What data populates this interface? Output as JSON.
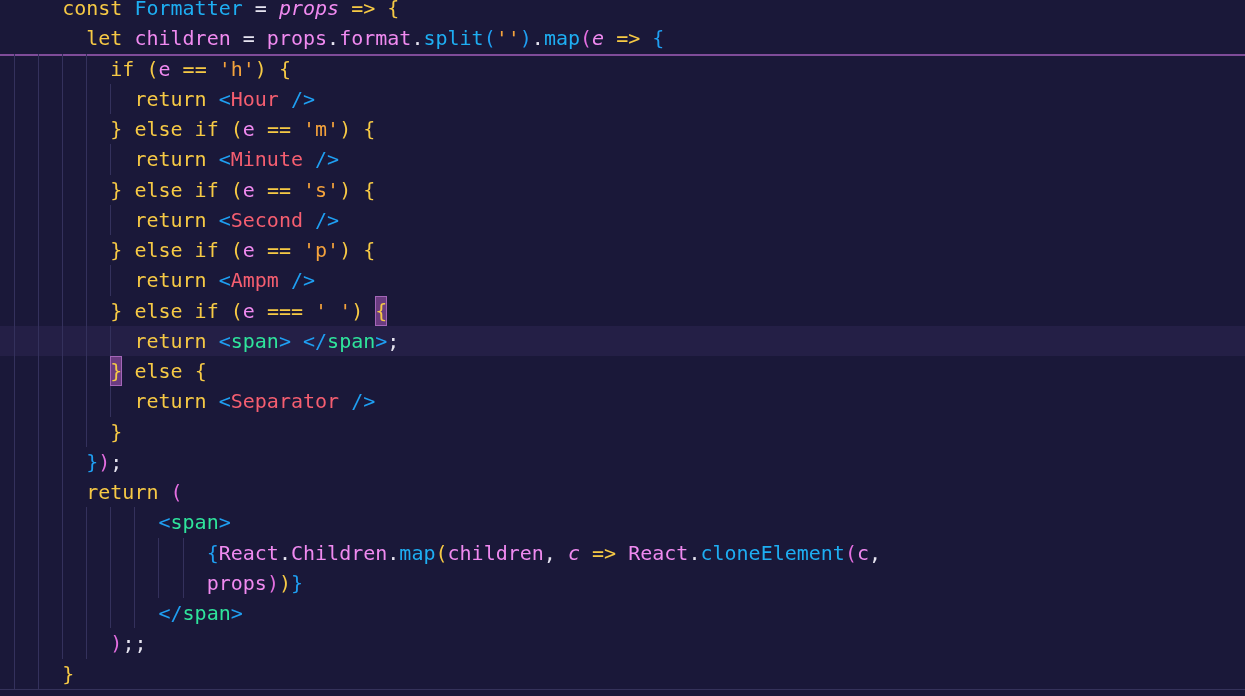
{
  "sticky_lines": [
    {
      "tokens": [
        {
          "text": "    const ",
          "kind": "kw"
        },
        {
          "text": "Formatter",
          "kind": "fn"
        },
        {
          "text": " = ",
          "kind": "plain"
        },
        {
          "text": "props",
          "kind": "param"
        },
        {
          "text": " => ",
          "kind": "kw"
        },
        {
          "text": "{",
          "kind": "b1"
        }
      ]
    },
    {
      "tokens": [
        {
          "text": "      let ",
          "kind": "kw"
        },
        {
          "text": "children",
          "kind": "var"
        },
        {
          "text": " = ",
          "kind": "plain"
        },
        {
          "text": "props",
          "kind": "var"
        },
        {
          "text": ".",
          "kind": "plain"
        },
        {
          "text": "format",
          "kind": "var"
        },
        {
          "text": ".",
          "kind": "plain"
        },
        {
          "text": "split",
          "kind": "fn"
        },
        {
          "text": "(",
          "kind": "b3"
        },
        {
          "text": "''",
          "kind": "str"
        },
        {
          "text": ")",
          "kind": "b3"
        },
        {
          "text": ".",
          "kind": "plain"
        },
        {
          "text": "map",
          "kind": "fn"
        },
        {
          "text": "(",
          "kind": "b2"
        },
        {
          "text": "e",
          "kind": "param"
        },
        {
          "text": " => ",
          "kind": "kw"
        },
        {
          "text": "{",
          "kind": "b3"
        }
      ]
    }
  ],
  "lines": [
    {
      "current": false,
      "tokens": [
        {
          "text": "        if ",
          "kind": "kw"
        },
        {
          "text": "(",
          "kind": "b1"
        },
        {
          "text": "e",
          "kind": "var"
        },
        {
          "text": " == ",
          "kind": "kw"
        },
        {
          "text": "'h'",
          "kind": "str"
        },
        {
          "text": ") ",
          "kind": "b1"
        },
        {
          "text": "{",
          "kind": "b1"
        }
      ]
    },
    {
      "current": false,
      "tokens": [
        {
          "text": "          return ",
          "kind": "kw"
        },
        {
          "text": "<",
          "kind": "angle"
        },
        {
          "text": "Hour",
          "kind": "comp"
        },
        {
          "text": " />",
          "kind": "angle"
        }
      ]
    },
    {
      "current": false,
      "tokens": [
        {
          "text": "        }",
          "kind": "b1"
        },
        {
          "text": " else if ",
          "kind": "kw"
        },
        {
          "text": "(",
          "kind": "b1"
        },
        {
          "text": "e",
          "kind": "var"
        },
        {
          "text": " == ",
          "kind": "kw"
        },
        {
          "text": "'m'",
          "kind": "str"
        },
        {
          "text": ") ",
          "kind": "b1"
        },
        {
          "text": "{",
          "kind": "b1"
        }
      ]
    },
    {
      "current": false,
      "tokens": [
        {
          "text": "          return ",
          "kind": "kw"
        },
        {
          "text": "<",
          "kind": "angle"
        },
        {
          "text": "Minute",
          "kind": "comp"
        },
        {
          "text": " />",
          "kind": "angle"
        }
      ]
    },
    {
      "current": false,
      "tokens": [
        {
          "text": "        }",
          "kind": "b1"
        },
        {
          "text": " else if ",
          "kind": "kw"
        },
        {
          "text": "(",
          "kind": "b1"
        },
        {
          "text": "e",
          "kind": "var"
        },
        {
          "text": " == ",
          "kind": "kw"
        },
        {
          "text": "'s'",
          "kind": "str"
        },
        {
          "text": ") ",
          "kind": "b1"
        },
        {
          "text": "{",
          "kind": "b1"
        }
      ]
    },
    {
      "current": false,
      "tokens": [
        {
          "text": "          return ",
          "kind": "kw"
        },
        {
          "text": "<",
          "kind": "angle"
        },
        {
          "text": "Second",
          "kind": "comp"
        },
        {
          "text": " />",
          "kind": "angle"
        }
      ]
    },
    {
      "current": false,
      "tokens": [
        {
          "text": "        }",
          "kind": "b1"
        },
        {
          "text": " else if ",
          "kind": "kw"
        },
        {
          "text": "(",
          "kind": "b1"
        },
        {
          "text": "e",
          "kind": "var"
        },
        {
          "text": " == ",
          "kind": "kw"
        },
        {
          "text": "'p'",
          "kind": "str"
        },
        {
          "text": ") ",
          "kind": "b1"
        },
        {
          "text": "{",
          "kind": "b1"
        }
      ]
    },
    {
      "current": false,
      "tokens": [
        {
          "text": "          return ",
          "kind": "kw"
        },
        {
          "text": "<",
          "kind": "angle"
        },
        {
          "text": "Ampm",
          "kind": "comp"
        },
        {
          "text": " />",
          "kind": "angle"
        }
      ]
    },
    {
      "current": false,
      "tokens": [
        {
          "text": "        }",
          "kind": "b1"
        },
        {
          "text": " else if ",
          "kind": "kw"
        },
        {
          "text": "(",
          "kind": "b1"
        },
        {
          "text": "e",
          "kind": "var"
        },
        {
          "text": " === ",
          "kind": "kw"
        },
        {
          "text": "' '",
          "kind": "str"
        },
        {
          "text": ") ",
          "kind": "b1"
        },
        {
          "text": "{",
          "kind": "b1",
          "matched": true
        }
      ]
    },
    {
      "current": true,
      "tokens": [
        {
          "text": "          return ",
          "kind": "kw"
        },
        {
          "text": "<",
          "kind": "angle"
        },
        {
          "text": "span",
          "kind": "tag"
        },
        {
          "text": "> </",
          "kind": "angle"
        },
        {
          "text": "span",
          "kind": "tag"
        },
        {
          "text": ">",
          "kind": "angle"
        },
        {
          "text": ";",
          "kind": "plain"
        }
      ]
    },
    {
      "current": false,
      "tokens": [
        {
          "text": "        }",
          "kind": "b1",
          "matched": true
        },
        {
          "text": " else ",
          "kind": "kw"
        },
        {
          "text": "{",
          "kind": "b1"
        }
      ]
    },
    {
      "current": false,
      "tokens": [
        {
          "text": "          return ",
          "kind": "kw"
        },
        {
          "text": "<",
          "kind": "angle"
        },
        {
          "text": "Separator",
          "kind": "comp"
        },
        {
          "text": " />",
          "kind": "angle"
        }
      ]
    },
    {
      "current": false,
      "tokens": [
        {
          "text": "        }",
          "kind": "b1"
        }
      ]
    },
    {
      "current": false,
      "tokens": [
        {
          "text": "      }",
          "kind": "b3"
        },
        {
          "text": ")",
          "kind": "b2"
        },
        {
          "text": ";",
          "kind": "plain"
        }
      ]
    },
    {
      "current": false,
      "tokens": [
        {
          "text": "      return ",
          "kind": "kw"
        },
        {
          "text": "(",
          "kind": "b2"
        }
      ]
    },
    {
      "current": false,
      "tokens": [
        {
          "text": "            <",
          "kind": "angle"
        },
        {
          "text": "span",
          "kind": "tag"
        },
        {
          "text": ">",
          "kind": "angle"
        }
      ]
    },
    {
      "current": false,
      "tokens": [
        {
          "text": "                {",
          "kind": "b3"
        },
        {
          "text": "React",
          "kind": "var"
        },
        {
          "text": ".",
          "kind": "plain"
        },
        {
          "text": "Children",
          "kind": "var"
        },
        {
          "text": ".",
          "kind": "plain"
        },
        {
          "text": "map",
          "kind": "fn"
        },
        {
          "text": "(",
          "kind": "b1"
        },
        {
          "text": "children",
          "kind": "var"
        },
        {
          "text": ", ",
          "kind": "plain"
        },
        {
          "text": "c",
          "kind": "param"
        },
        {
          "text": " => ",
          "kind": "kw"
        },
        {
          "text": "React",
          "kind": "var"
        },
        {
          "text": ".",
          "kind": "plain"
        },
        {
          "text": "cloneElement",
          "kind": "fn"
        },
        {
          "text": "(",
          "kind": "b2"
        },
        {
          "text": "c",
          "kind": "var"
        },
        {
          "text": ",",
          "kind": "plain"
        }
      ]
    },
    {
      "current": false,
      "tokens": [
        {
          "text": "                props",
          "kind": "var"
        },
        {
          "text": ")",
          "kind": "b2"
        },
        {
          "text": ")",
          "kind": "b1"
        },
        {
          "text": "}",
          "kind": "b3"
        }
      ]
    },
    {
      "current": false,
      "tokens": [
        {
          "text": "            </",
          "kind": "angle"
        },
        {
          "text": "span",
          "kind": "tag"
        },
        {
          "text": ">",
          "kind": "angle"
        }
      ]
    },
    {
      "current": false,
      "tokens": [
        {
          "text": "        )",
          "kind": "b2"
        },
        {
          "text": ";;",
          "kind": "plain"
        }
      ]
    },
    {
      "current": false,
      "tokens": [
        {
          "text": "    }",
          "kind": "b1"
        }
      ]
    }
  ]
}
